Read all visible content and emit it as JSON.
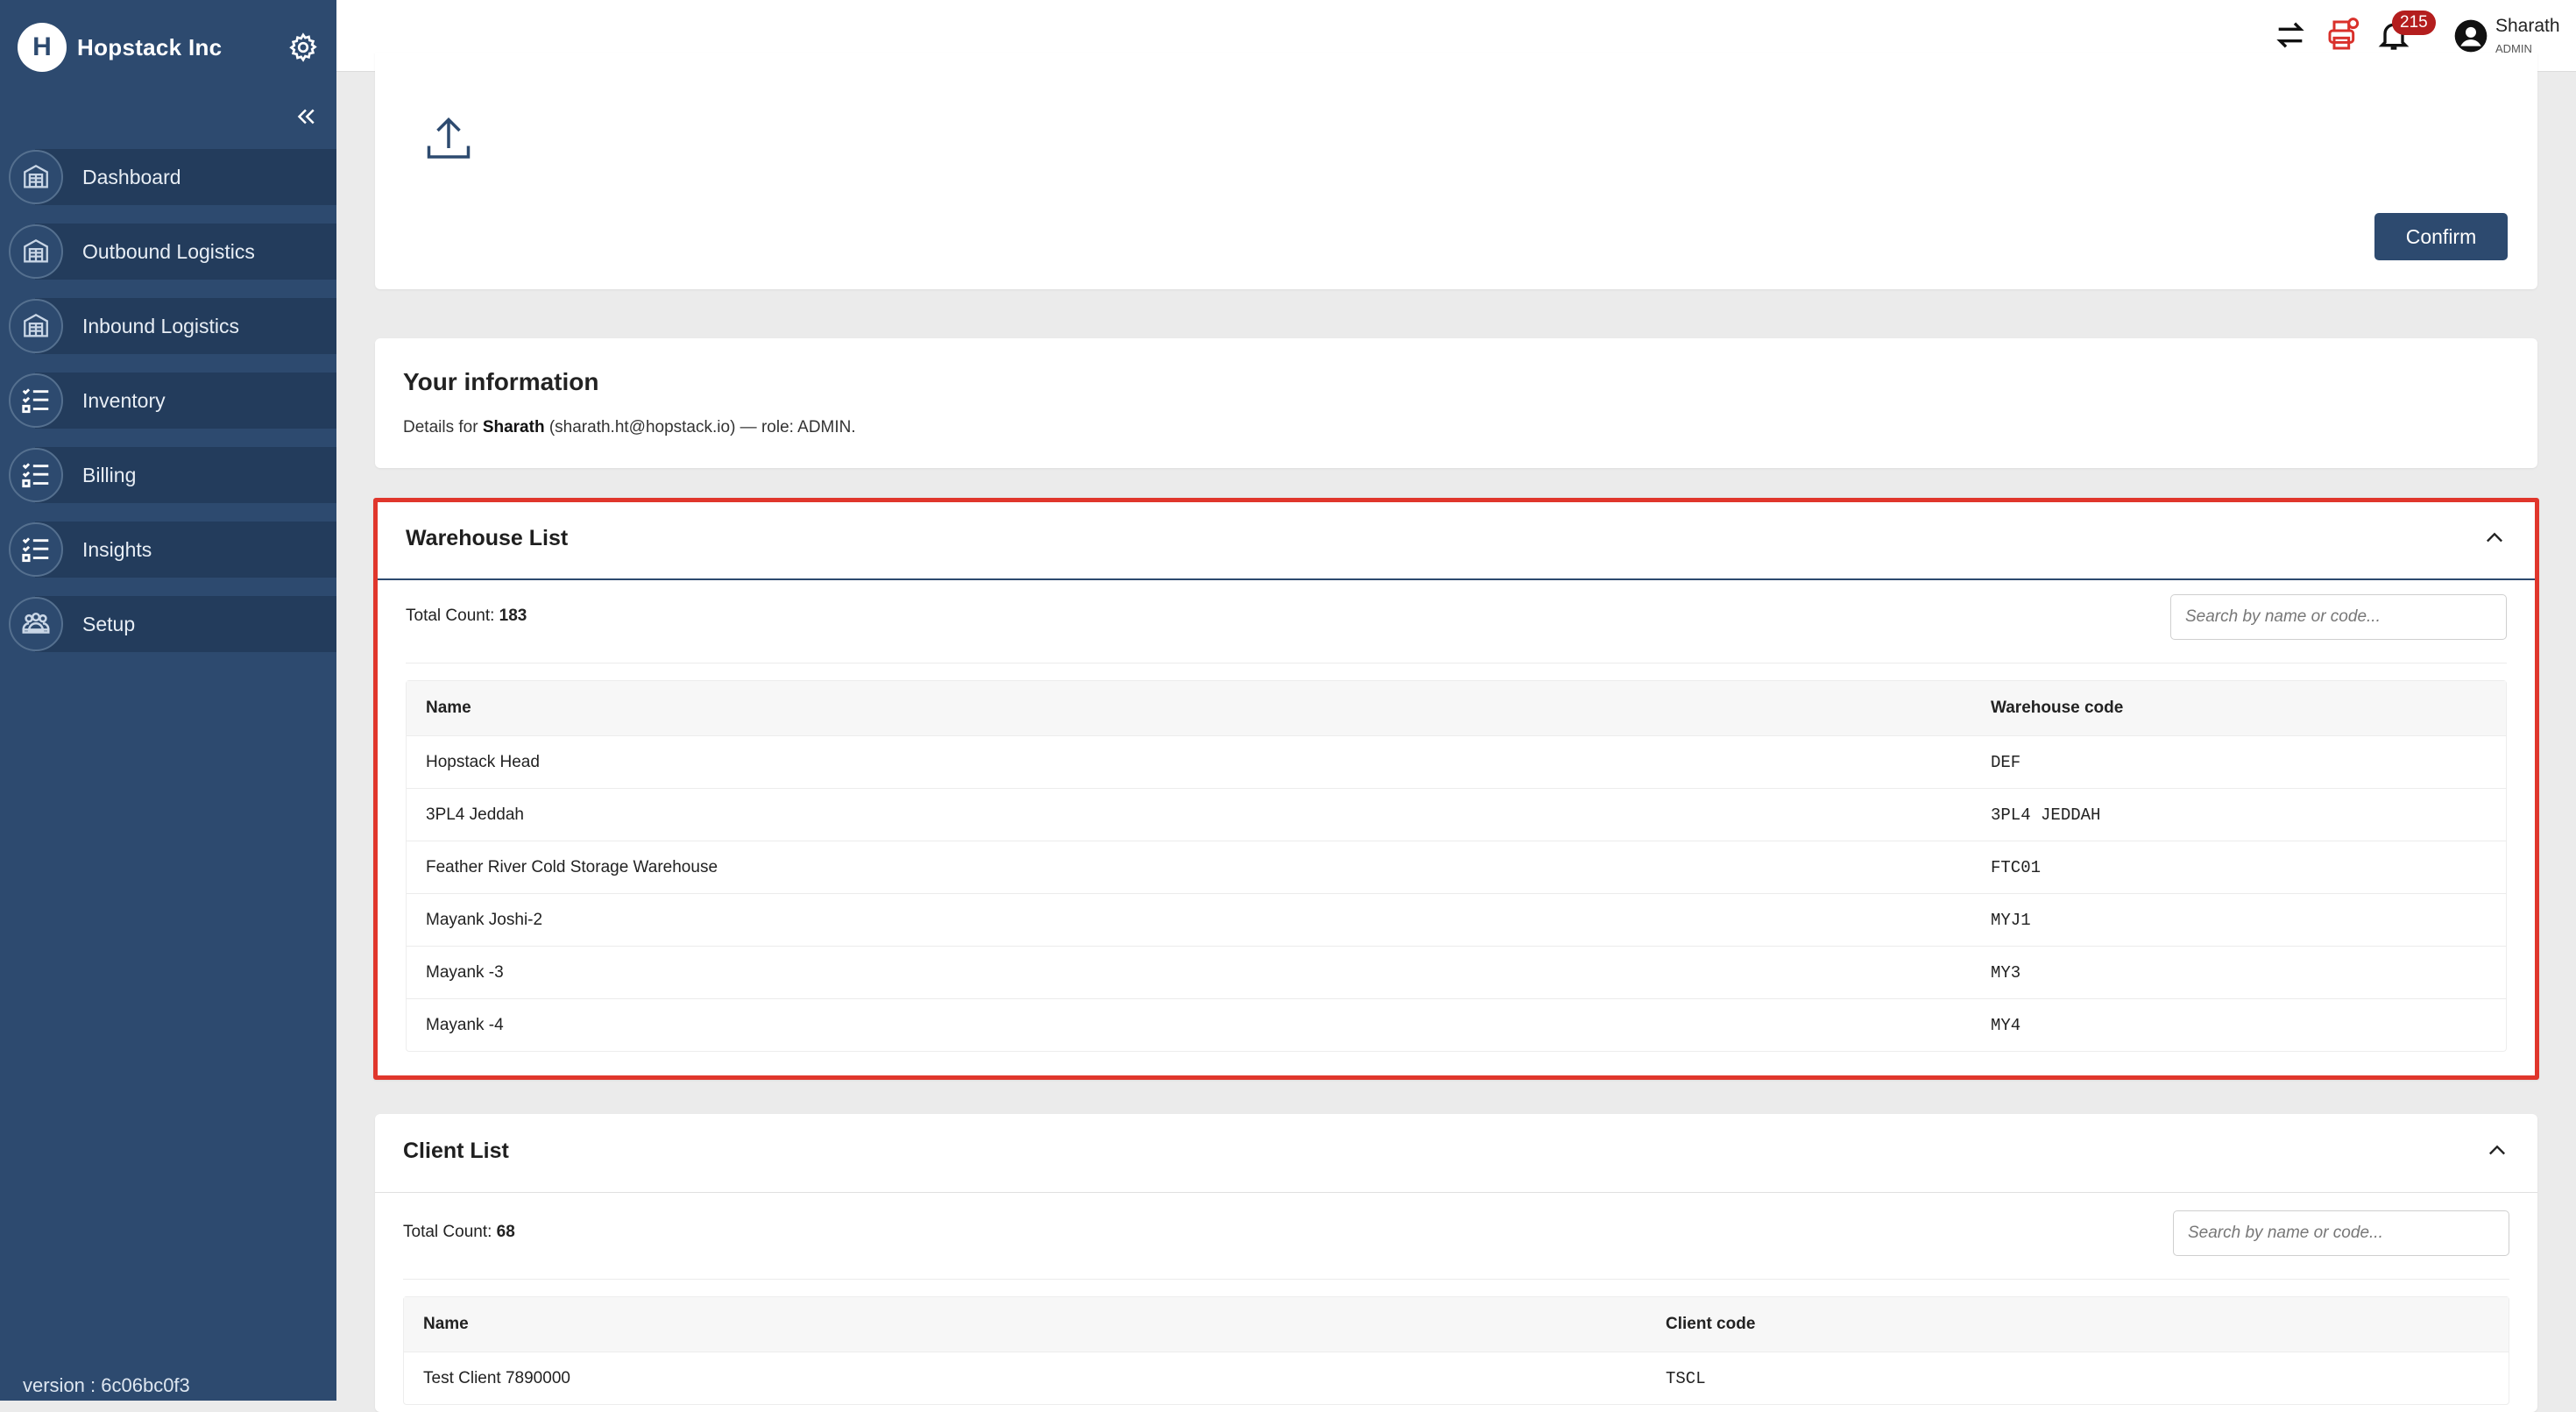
{
  "sidebar": {
    "brand_logo": "H",
    "brand_name": "Hopstack Inc",
    "items": [
      {
        "label": "Dashboard",
        "icon": "warehouse-icon"
      },
      {
        "label": "Outbound Logistics",
        "icon": "warehouse-icon"
      },
      {
        "label": "Inbound Logistics",
        "icon": "warehouse-icon"
      },
      {
        "label": "Inventory",
        "icon": "checklist-icon"
      },
      {
        "label": "Billing",
        "icon": "checklist-icon"
      },
      {
        "label": "Insights",
        "icon": "checklist-icon"
      },
      {
        "label": "Setup",
        "icon": "people-icon"
      }
    ],
    "version": "version : 6c06bc0f3"
  },
  "topbar": {
    "notification_count": "215",
    "user_name": "Sharath",
    "user_role": "ADMIN"
  },
  "upload": {
    "confirm_label": "Confirm"
  },
  "info": {
    "title": "Your information",
    "prefix": "Details for ",
    "name": "Sharath",
    "suffix": " (sharath.ht@hopstack.io) — role: ADMIN."
  },
  "warehouse_list": {
    "title": "Warehouse List",
    "count_label": "Total Count: ",
    "count": "183",
    "search_placeholder": "Search by name or code...",
    "columns": [
      "Name",
      "Warehouse code"
    ],
    "rows": [
      {
        "name": "Hopstack Head",
        "code": "DEF"
      },
      {
        "name": "3PL4 Jeddah",
        "code": "3PL4 JEDDAH"
      },
      {
        "name": "Feather River Cold Storage Warehouse",
        "code": "FTC01"
      },
      {
        "name": "Mayank Joshi-2",
        "code": "MYJ1"
      },
      {
        "name": "Mayank -3",
        "code": "MY3"
      },
      {
        "name": "Mayank -4",
        "code": "MY4"
      }
    ]
  },
  "client_list": {
    "title": "Client List",
    "count_label": "Total Count: ",
    "count": "68",
    "search_placeholder": "Search by name or code...",
    "columns": [
      "Name",
      "Client code"
    ],
    "rows": [
      {
        "name": "Test Client 7890000",
        "code": "TSCL"
      }
    ]
  }
}
